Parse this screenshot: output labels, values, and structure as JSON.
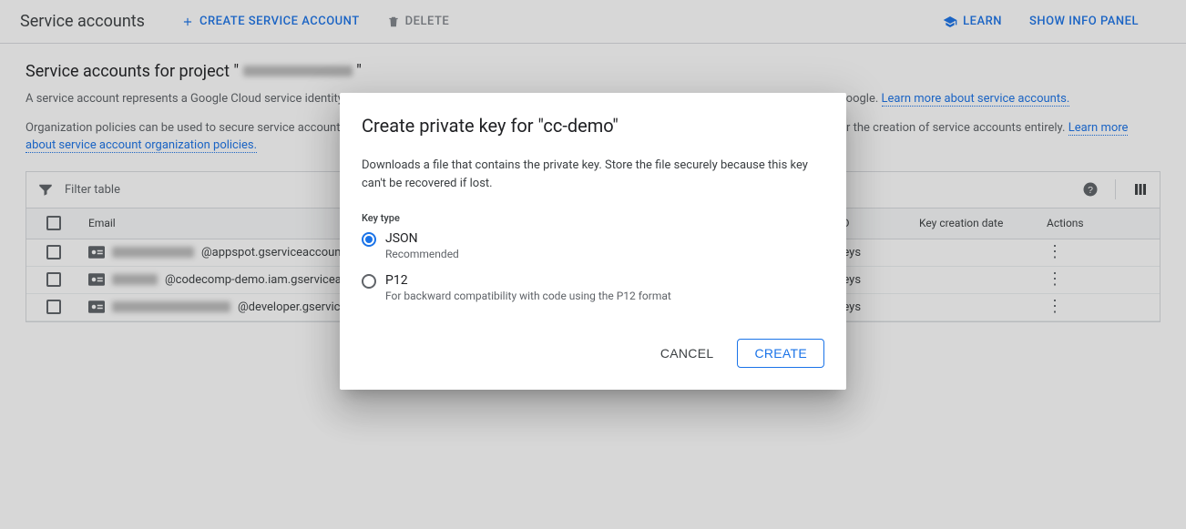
{
  "topbar": {
    "title": "Service accounts",
    "create_label": "CREATE SERVICE ACCOUNT",
    "delete_label": "DELETE",
    "learn_label": "LEARN",
    "info_panel_label": "SHOW INFO PANEL"
  },
  "main": {
    "section_title_prefix": "Service accounts for project \"",
    "section_title_suffix": "\"",
    "desc1_text": "A service account represents a Google Cloud service identity, such as code running on Compute Engine VMs, App Engine apps, or systems running outside Google. ",
    "desc1_link": "Learn more about service accounts.",
    "desc2_text": "Organization policies can be used to secure service accounts and block risky service account features, such as automatic IAM Grants, key creation/upload, or the creation of service accounts entirely. ",
    "desc2_link": "Learn more about service account organization policies."
  },
  "table": {
    "filter_label": "Filter table",
    "cols": {
      "email": "Email",
      "keyid": "Key ID",
      "keydate": "Key creation date",
      "actions": "Actions"
    },
    "rows": [
      {
        "email_suffix": "@appspot.gserviceaccount.com",
        "keyid": "No keys"
      },
      {
        "email_suffix": "@codecomp-demo.iam.gserviceaccount.com",
        "keyid": "No keys"
      },
      {
        "email_suffix": "@developer.gserviceaccount.com",
        "keyid": "No keys"
      }
    ]
  },
  "dialog": {
    "title": "Create private key for \"cc-demo\"",
    "hint": "Downloads a file that contains the private key. Store the file securely because this key can't be recovered if lost.",
    "key_type_label": "Key type",
    "options": [
      {
        "label": "JSON",
        "sub": "Recommended",
        "selected": true
      },
      {
        "label": "P12",
        "sub": "For backward compatibility with code using the P12 format",
        "selected": false
      }
    ],
    "cancel": "CANCEL",
    "create": "CREATE"
  }
}
